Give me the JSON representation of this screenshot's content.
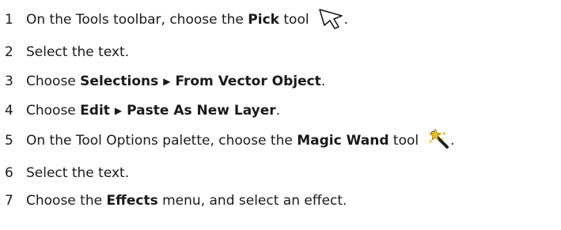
{
  "steps": [
    {
      "number": "1",
      "parts": [
        "On the Tools toolbar, choose the ",
        "Pick",
        " tool",
        "."
      ],
      "icon": "pick-arrow-icon"
    },
    {
      "number": "2",
      "parts": [
        "Select the text."
      ]
    },
    {
      "number": "3",
      "parts": [
        "Choose ",
        "Selections",
        "From Vector Object",
        "."
      ]
    },
    {
      "number": "4",
      "parts": [
        "Choose ",
        "Edit",
        "Paste As New Layer",
        "."
      ]
    },
    {
      "number": "5",
      "parts": [
        "On the Tool Options palette, choose the ",
        "Magic Wand",
        " tool",
        "."
      ],
      "icon": "magic-wand-icon"
    },
    {
      "number": "6",
      "parts": [
        "Select the text."
      ]
    },
    {
      "number": "7",
      "parts": [
        "Choose the ",
        "Effects",
        " menu, and select an effect."
      ]
    }
  ],
  "menu_arrow": "▶",
  "colors": {
    "text": "#1a1a1a",
    "wand_star": "#e8c020",
    "wand_shaft": "#222222"
  }
}
